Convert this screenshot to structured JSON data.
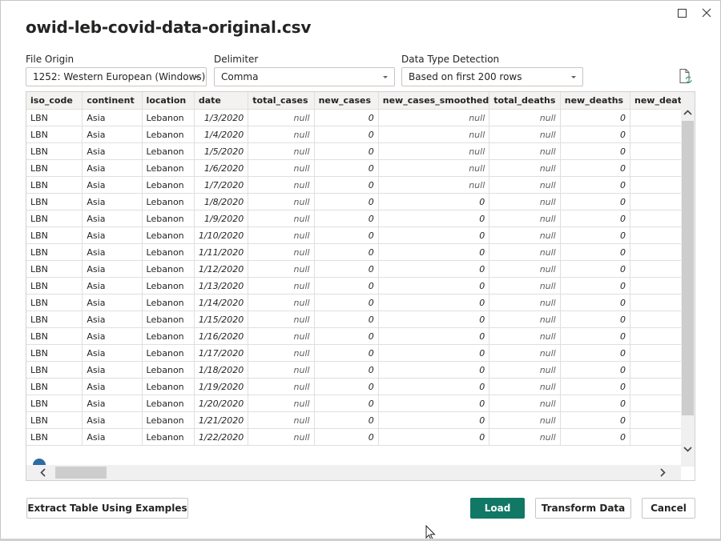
{
  "window": {
    "title": "owid-leb-covid-data-original.csv",
    "controls": {
      "maximize_icon": "square-icon",
      "close_icon": "x-icon"
    }
  },
  "options": {
    "file_origin": {
      "label": "File Origin",
      "value": "1252: Western European (Windows)"
    },
    "delimiter": {
      "label": "Delimiter",
      "value": "Comma"
    },
    "data_type_detection": {
      "label": "Data Type Detection",
      "value": "Based on first 200 rows"
    },
    "refresh_icon": "refresh-document-icon"
  },
  "table": {
    "columns": [
      "iso_code",
      "continent",
      "location",
      "date",
      "total_cases",
      "new_cases",
      "new_cases_smoothed",
      "total_deaths",
      "new_deaths",
      "new_deaths"
    ],
    "rows": [
      [
        "LBN",
        "Asia",
        "Lebanon",
        "1/3/2020",
        "null",
        "0",
        "null",
        "null",
        "0",
        ""
      ],
      [
        "LBN",
        "Asia",
        "Lebanon",
        "1/4/2020",
        "null",
        "0",
        "null",
        "null",
        "0",
        ""
      ],
      [
        "LBN",
        "Asia",
        "Lebanon",
        "1/5/2020",
        "null",
        "0",
        "null",
        "null",
        "0",
        ""
      ],
      [
        "LBN",
        "Asia",
        "Lebanon",
        "1/6/2020",
        "null",
        "0",
        "null",
        "null",
        "0",
        ""
      ],
      [
        "LBN",
        "Asia",
        "Lebanon",
        "1/7/2020",
        "null",
        "0",
        "null",
        "null",
        "0",
        ""
      ],
      [
        "LBN",
        "Asia",
        "Lebanon",
        "1/8/2020",
        "null",
        "0",
        "0",
        "null",
        "0",
        ""
      ],
      [
        "LBN",
        "Asia",
        "Lebanon",
        "1/9/2020",
        "null",
        "0",
        "0",
        "null",
        "0",
        ""
      ],
      [
        "LBN",
        "Asia",
        "Lebanon",
        "1/10/2020",
        "null",
        "0",
        "0",
        "null",
        "0",
        ""
      ],
      [
        "LBN",
        "Asia",
        "Lebanon",
        "1/11/2020",
        "null",
        "0",
        "0",
        "null",
        "0",
        ""
      ],
      [
        "LBN",
        "Asia",
        "Lebanon",
        "1/12/2020",
        "null",
        "0",
        "0",
        "null",
        "0",
        ""
      ],
      [
        "LBN",
        "Asia",
        "Lebanon",
        "1/13/2020",
        "null",
        "0",
        "0",
        "null",
        "0",
        ""
      ],
      [
        "LBN",
        "Asia",
        "Lebanon",
        "1/14/2020",
        "null",
        "0",
        "0",
        "null",
        "0",
        ""
      ],
      [
        "LBN",
        "Asia",
        "Lebanon",
        "1/15/2020",
        "null",
        "0",
        "0",
        "null",
        "0",
        ""
      ],
      [
        "LBN",
        "Asia",
        "Lebanon",
        "1/16/2020",
        "null",
        "0",
        "0",
        "null",
        "0",
        ""
      ],
      [
        "LBN",
        "Asia",
        "Lebanon",
        "1/17/2020",
        "null",
        "0",
        "0",
        "null",
        "0",
        ""
      ],
      [
        "LBN",
        "Asia",
        "Lebanon",
        "1/18/2020",
        "null",
        "0",
        "0",
        "null",
        "0",
        ""
      ],
      [
        "LBN",
        "Asia",
        "Lebanon",
        "1/19/2020",
        "null",
        "0",
        "0",
        "null",
        "0",
        ""
      ],
      [
        "LBN",
        "Asia",
        "Lebanon",
        "1/20/2020",
        "null",
        "0",
        "0",
        "null",
        "0",
        ""
      ],
      [
        "LBN",
        "Asia",
        "Lebanon",
        "1/21/2020",
        "null",
        "0",
        "0",
        "null",
        "0",
        ""
      ],
      [
        "LBN",
        "Asia",
        "Lebanon",
        "1/22/2020",
        "null",
        "0",
        "0",
        "null",
        "0",
        ""
      ]
    ],
    "notice_icon": "info-icon"
  },
  "footer": {
    "extract_button": "Extract Table Using Examples",
    "load_button": "Load",
    "transform_button": "Transform Data",
    "cancel_button": "Cancel"
  },
  "colors": {
    "primary": "#117865",
    "border": "#c8c6c4",
    "header_bg": "#f3f2f1"
  }
}
